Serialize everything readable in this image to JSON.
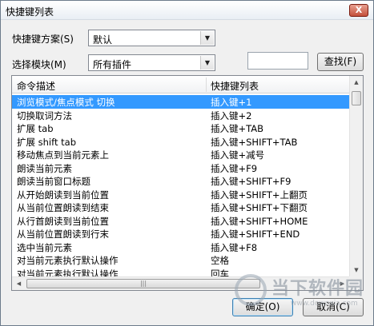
{
  "window": {
    "title": "快捷键列表",
    "close_glyph": "X"
  },
  "scheme": {
    "label": "快捷键方案(S)",
    "value": "默认"
  },
  "module": {
    "label": "选择模块(M)",
    "value": "所有插件"
  },
  "search": {
    "value": "",
    "button_label": "查找(F)"
  },
  "list": {
    "columns": [
      "命令描述",
      "快捷键列表"
    ],
    "rows": [
      {
        "desc": "浏览模式/焦点模式 切换",
        "key": "插入键+1",
        "selected": true
      },
      {
        "desc": "切换取词方法",
        "key": "插入键+2"
      },
      {
        "desc": "扩展 tab",
        "key": "插入键+TAB"
      },
      {
        "desc": "扩展 shift tab",
        "key": "插入键+SHIFT+TAB"
      },
      {
        "desc": "移动焦点到当前元素上",
        "key": "插入键+减号"
      },
      {
        "desc": "朗读当前元素",
        "key": "插入键+F9"
      },
      {
        "desc": "朗读当前窗口标题",
        "key": "插入键+SHIFT+F9"
      },
      {
        "desc": "从开始朗读到当前位置",
        "key": "插入键+SHIFT+上翻页"
      },
      {
        "desc": "从当前位置朗读到结束",
        "key": "插入键+SHIFT+下翻页"
      },
      {
        "desc": "从行首朗读到当前位置",
        "key": "插入键+SHIFT+HOME"
      },
      {
        "desc": "从当前位置朗读到行末",
        "key": "插入键+SHIFT+END"
      },
      {
        "desc": "选中当前元素",
        "key": "插入键+F8"
      },
      {
        "desc": "对当前元素执行默认操作",
        "key": "空格"
      },
      {
        "desc": "对当前元素执行默认操作",
        "key": "回车"
      }
    ]
  },
  "buttons": {
    "ok": "确定(O)",
    "cancel": "取消(C)"
  },
  "watermark": {
    "text": "当下软件园",
    "sub": "www.downxia.com"
  },
  "colors": {
    "selection": "#3399ff",
    "close": "#c4513c"
  }
}
